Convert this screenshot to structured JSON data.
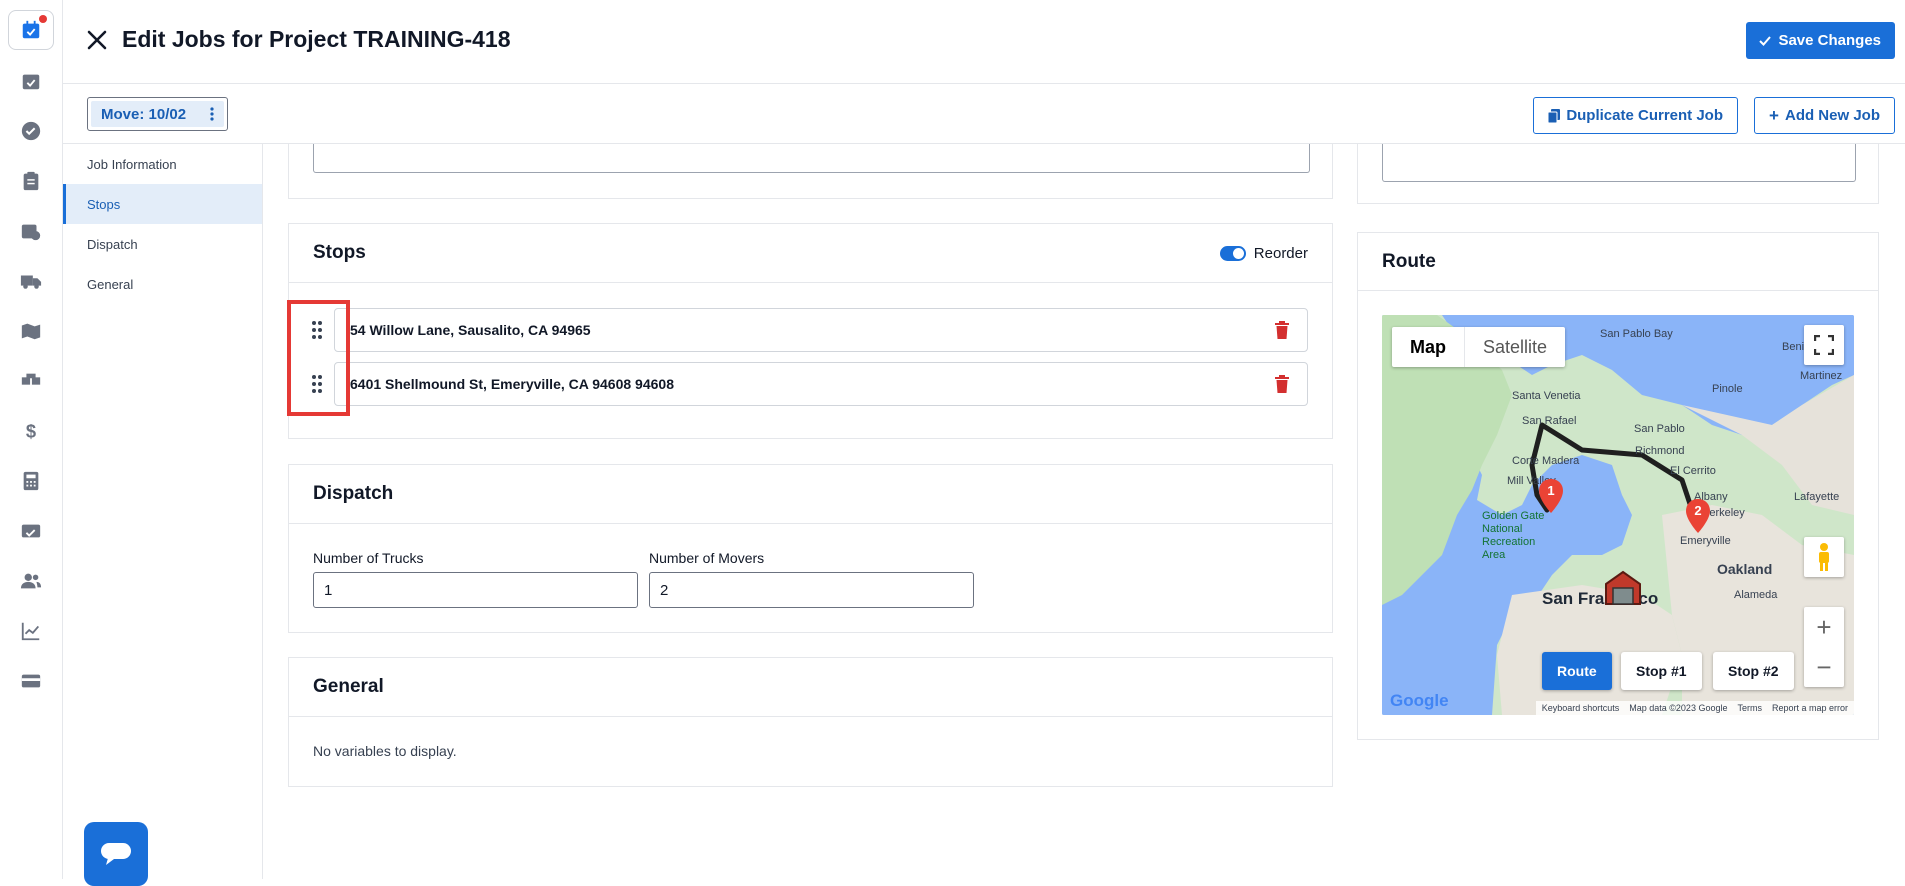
{
  "header": {
    "title": "Edit Jobs for Project TRAINING-418",
    "save_label": "Save Changes"
  },
  "subbar": {
    "move_label": "Move: 10/02",
    "duplicate_label": "Duplicate Current Job",
    "add_label": "Add New Job"
  },
  "sidenav": {
    "items": [
      {
        "label": "Job Information",
        "active": false
      },
      {
        "label": "Stops",
        "active": true
      },
      {
        "label": "Dispatch",
        "active": false
      },
      {
        "label": "General",
        "active": false
      }
    ]
  },
  "stops": {
    "title": "Stops",
    "reorder_label": "Reorder",
    "reorder_on": true,
    "items": [
      {
        "address": "54 Willow Lane, Sausalito, CA 94965"
      },
      {
        "address": "6401 Shellmound St, Emeryville, CA 94608 94608"
      }
    ]
  },
  "dispatch": {
    "title": "Dispatch",
    "trucks_label": "Number of Trucks",
    "trucks_value": "1",
    "movers_label": "Number of Movers",
    "movers_value": "2"
  },
  "general": {
    "title": "General",
    "empty_text": "No variables to display."
  },
  "route": {
    "title": "Route",
    "map_tab": "Map",
    "satellite_tab": "Satellite",
    "buttons": [
      "Route",
      "Stop #1",
      "Stop #2"
    ],
    "markers": [
      "1",
      "2"
    ],
    "places": {
      "san_pablo_bay": "San Pablo Bay",
      "santa_venetia": "Santa Venetia",
      "san_rafael": "San Rafael",
      "pinole": "Pinole",
      "martinez": "Martinez",
      "benicia": "Benic",
      "san_pablo": "San Pablo",
      "richmond": "Richmond",
      "corte_madera": "Corte Madera",
      "el_cerrito": "El Cerrito",
      "mill_valley": "Mill Valley",
      "albany": "Albany",
      "lafayette": "Lafayette",
      "berkeley": "Berkeley",
      "golden_gate": "Golden Gate National Recreation Area",
      "emeryville": "Emeryville",
      "oakland": "Oakland",
      "san_francisco": "San Francisco",
      "alameda": "Alameda"
    },
    "google": "Google",
    "attribution": [
      "Keyboard shortcuts",
      "Map data ©2023 Google",
      "Terms",
      "Report a map error"
    ]
  },
  "colors": {
    "primary": "#1a6fd8",
    "danger": "#d32f2f",
    "highlight": "#e53935",
    "water": "#8ab4f8",
    "land": "#d7ecd4",
    "route": "#1f1f1f"
  }
}
